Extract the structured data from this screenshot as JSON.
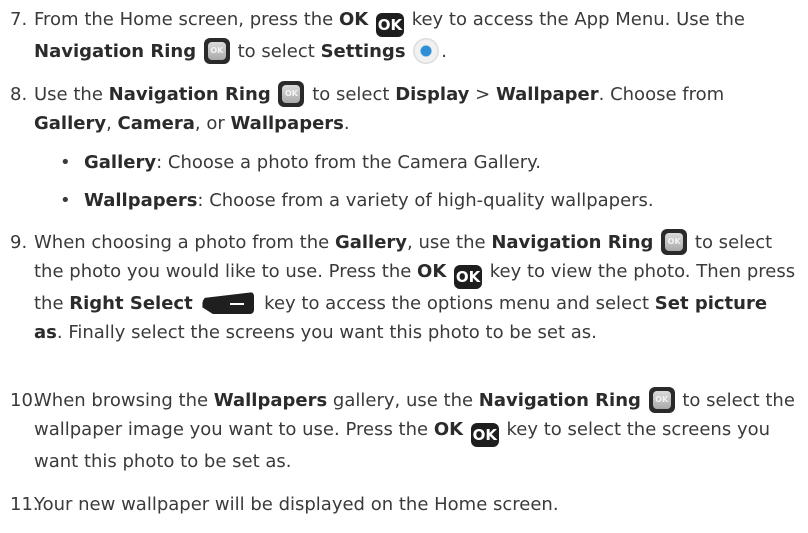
{
  "steps": [
    {
      "num": "7.",
      "t1": "From the Home screen, press the ",
      "b1": "OK",
      "icon_label": "OK",
      "t2": " key to access the App Menu. Use the ",
      "b2": "Navigation Ring",
      "t3": " to select ",
      "b3": "Settings",
      "t4": "."
    },
    {
      "num": "8.",
      "t1": "Use the ",
      "b1": "Navigation Ring",
      "t2": " to select ",
      "b2": "Display",
      "t3": " > ",
      "b3": "Wallpaper",
      "t4": ". Choose from ",
      "b4": "Gallery",
      "t5": ", ",
      "b5": "Camera",
      "t6": ", or ",
      "b6": "Wallpapers",
      "t7": ".",
      "bullets": [
        {
          "b": "Gallery",
          "t": ": Choose a photo from the Camera Gallery."
        },
        {
          "b": "Wallpapers",
          "t": ": Choose from a variety of high-quality wallpapers."
        }
      ]
    },
    {
      "num": "9.",
      "t1": "When choosing a photo from the ",
      "b1": "Gallery",
      "t2": ", use the ",
      "b2": "Navigation Ring",
      "t3": " to select the photo you would like to use. Press the ",
      "b3": "OK",
      "icon_label": "OK",
      "t4": " key to view the photo. Then press the ",
      "b4": "Right Select",
      "t5": " key to access the options menu and select ",
      "b5": "Set picture as",
      "t6": ". Finally select the screens you want this photo to be set as."
    },
    {
      "num": "10.",
      "t1": "When browsing the ",
      "b1": "Wallpapers",
      "t2": " gallery, use the ",
      "b2": "Navigation Ring",
      "t3": " to select the wallpaper image you want to use. Press the ",
      "b3": "OK",
      "icon_label": "OK",
      "t4": " key to select the screens you want this photo to be set as."
    },
    {
      "num": "11.",
      "t1": "Your new wallpaper will be displayed on the Home screen."
    }
  ],
  "bullet_char": "•",
  "icons": {
    "ok_key": "ok-key-icon",
    "nav_ring": "navigation-ring-icon",
    "settings": "settings-icon",
    "right_select": "right-select-key-icon"
  }
}
